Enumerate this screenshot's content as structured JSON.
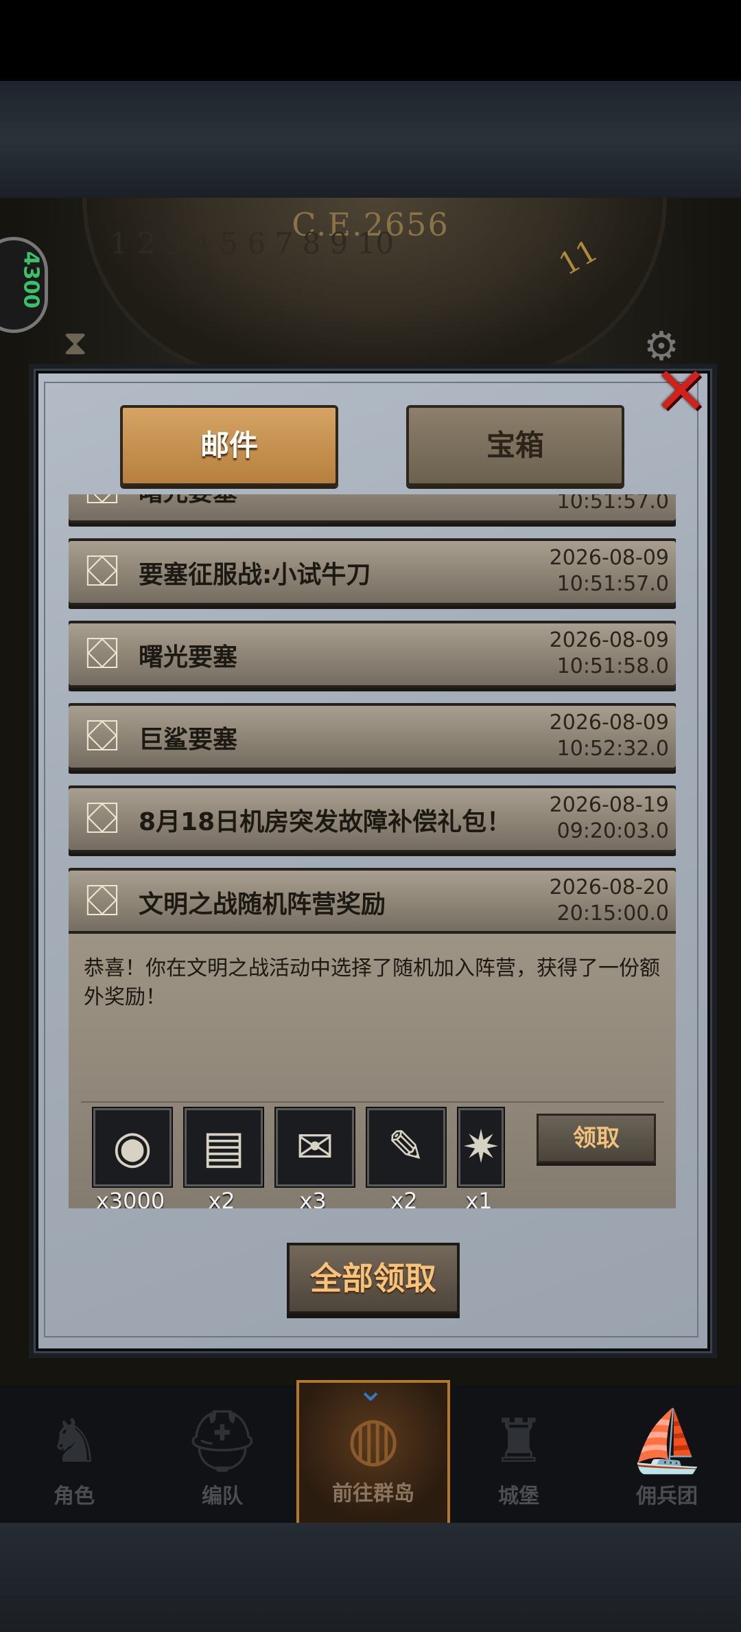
{
  "header": {
    "year": "C.E.2656",
    "dial_numbers": "1 2 3 4 5 6 7 8 9 10",
    "dial_highlight": "11",
    "side_value": "4300"
  },
  "tabs": {
    "mail": "邮件",
    "chest": "宝箱"
  },
  "mails": [
    {
      "title": "曙光要塞",
      "date": "",
      "time": "10:51:57.0"
    },
    {
      "title": "要塞征服战:小试牛刀",
      "date": "2026-08-09",
      "time": "10:51:57.0"
    },
    {
      "title": "曙光要塞",
      "date": "2026-08-09",
      "time": "10:51:58.0"
    },
    {
      "title": "巨鲨要塞",
      "date": "2026-08-09",
      "time": "10:52:32.0"
    },
    {
      "title": "8月18日机房突发故障补偿礼包！",
      "date": "2026-08-19",
      "time": "09:20:03.0"
    },
    {
      "title": "文明之战随机阵营奖励",
      "date": "2026-08-20",
      "time": "20:15:00.0"
    }
  ],
  "detail": {
    "text": "恭喜！你在文明之战活动中选择了随机加入阵营，获得了一份额外奖励！",
    "items": [
      {
        "icon": "silver-coin-icon",
        "qty": "x3000"
      },
      {
        "icon": "map-scroll-icon",
        "qty": "x2"
      },
      {
        "icon": "scroll-icon",
        "qty": "x3"
      },
      {
        "icon": "sealed-scroll-icon",
        "qty": "x2"
      },
      {
        "icon": "compass-star-icon",
        "qty": "x1"
      }
    ],
    "claim_label": "领取"
  },
  "claim_all_label": "全部领取",
  "nav": [
    {
      "label": "角色",
      "icon": "knight-icon"
    },
    {
      "label": "编队",
      "icon": "helmet-icon"
    },
    {
      "label": "前往群岛",
      "icon": "island-icon"
    },
    {
      "label": "城堡",
      "icon": "castle-icon"
    },
    {
      "label": "佣兵团",
      "icon": "ship-icon"
    }
  ],
  "colors": {
    "close": "#d4201a",
    "tab_active": "#c48f4d",
    "claim_text": "#f8c27a",
    "nav_highlight": "#b3782a"
  }
}
